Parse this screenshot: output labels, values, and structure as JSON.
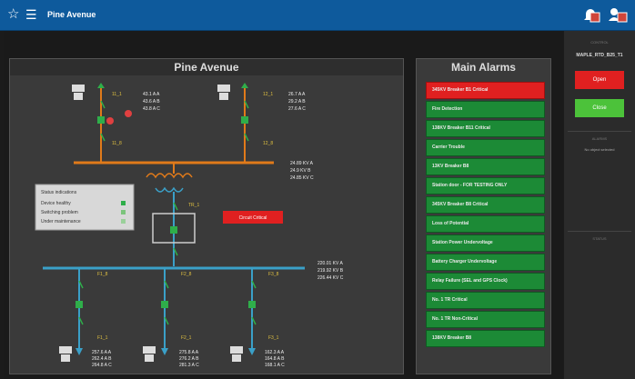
{
  "header": {
    "title": "Pine Avenue",
    "star_icon": "star-icon",
    "menu_icon": "hamburger-menu-icon",
    "alerts_icon": "alerts-icon",
    "users_icon": "users-icon"
  },
  "diagram": {
    "title": "Pine Avenue",
    "top_left_meas": [
      "43.1 A A",
      "43.6 A B",
      "43.8 A C"
    ],
    "top_right_meas": [
      "26.7 A A",
      "29.2 A B",
      "27.6 A C"
    ],
    "bus_kv_top": [
      "24.89 KV A",
      "24.9 KV B",
      "24.85 KV C"
    ],
    "bus_kv_main": [
      "220.01 KV A",
      "219.92 KV B",
      "226.44 KV C"
    ],
    "fault_label": "Circuit Critical",
    "status_box": {
      "title": "Status indications",
      "rows": [
        "Device healthy",
        "Switching problem",
        "Under maintenance"
      ]
    },
    "bottom_meas": [
      [
        "257.6 A A",
        "262.4 A B",
        "264.8 A C"
      ],
      [
        "275.8 A A",
        "276.2 A B",
        "281.3 A C"
      ],
      [
        "162.3 A A",
        "164.8 A B",
        "168.1 A C"
      ]
    ]
  },
  "alarms": {
    "title": "Main Alarms",
    "items": [
      {
        "label": "345KV Breaker B1 Critical",
        "color": "#e02020"
      },
      {
        "label": "Fire Detection",
        "color": "#1c8a36"
      },
      {
        "label": "138KV Breaker B11 Critical",
        "color": "#1c8a36"
      },
      {
        "label": "Carrier Trouble",
        "color": "#1c8a36"
      },
      {
        "label": "13KV Breaker B8",
        "color": "#1c8a36"
      },
      {
        "label": "Station door - FOR TESTING ONLY",
        "color": "#1c8a36"
      },
      {
        "label": "345KV Breaker B8 Critical",
        "color": "#1c8a36"
      },
      {
        "label": "Loss of Potential",
        "color": "#1c8a36"
      },
      {
        "label": "Station Power Undervoltage",
        "color": "#1c8a36"
      },
      {
        "label": "Battery Charger Undervoltage",
        "color": "#1c8a36"
      },
      {
        "label": "Relay Failure (SEL and GPS Clock)",
        "color": "#1c8a36"
      },
      {
        "label": "No. 1 TR Critical",
        "color": "#1c8a36"
      },
      {
        "label": "No. 1 TR Non-Critical",
        "color": "#1c8a36"
      },
      {
        "label": "138KV Breaker B8",
        "color": "#1c8a36"
      }
    ]
  },
  "sidebar": {
    "control_label": "CONTROL",
    "device_name": "MAPLE_RTD_B25_T1",
    "open_label": "Open",
    "close_label": "Close",
    "alarms_label": "ALARMS",
    "alarms_empty": "No object selected",
    "status_label": "STATUS"
  },
  "colors": {
    "topbar": "#0e5a9c",
    "alarm_green": "#1c8a36",
    "alarm_red": "#e02020",
    "bus_orange": "#e07a1a",
    "bus_blue": "#3aa0c8",
    "breaker_green": "#2fae4a"
  }
}
